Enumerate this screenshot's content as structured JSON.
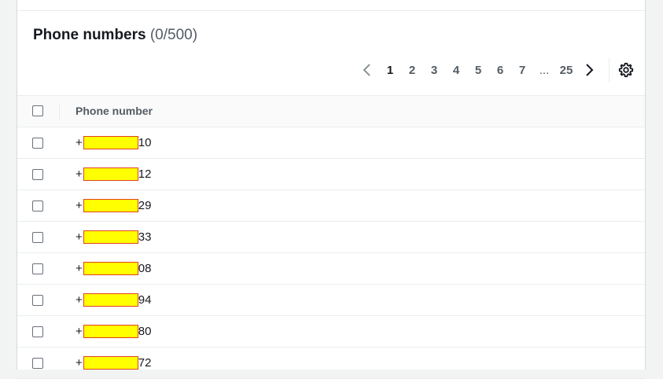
{
  "panel": {
    "title": "Phone numbers",
    "count": "(0/500)"
  },
  "pagination": {
    "prev_icon": "chevron-left-icon",
    "next_icon": "chevron-right-icon",
    "pages": [
      "1",
      "2",
      "3",
      "4",
      "5",
      "6",
      "7"
    ],
    "active_page": "1",
    "ellipsis": "...",
    "last_page": "25",
    "settings_icon": "gear-icon"
  },
  "table": {
    "column_header": "Phone number",
    "rows": [
      {
        "prefix": "+",
        "suffix": "10"
      },
      {
        "prefix": "+",
        "suffix": "12"
      },
      {
        "prefix": "+",
        "suffix": "29"
      },
      {
        "prefix": "+",
        "suffix": "33"
      },
      {
        "prefix": "+",
        "suffix": "08"
      },
      {
        "prefix": "+",
        "suffix": "94"
      },
      {
        "prefix": "+",
        "suffix": "80"
      },
      {
        "prefix": "+",
        "suffix": "72"
      }
    ]
  },
  "colors": {
    "redaction_fill": "#ffff00",
    "redaction_border": "#e0421e",
    "text_primary": "#16191f",
    "text_secondary": "#545b64"
  }
}
